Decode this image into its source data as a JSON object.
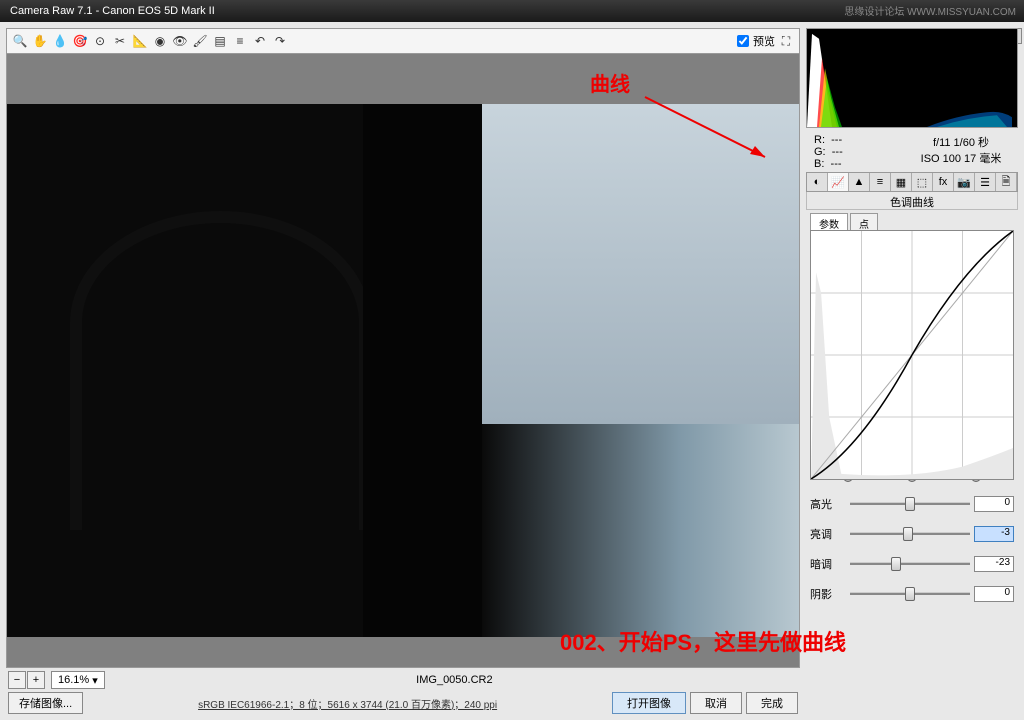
{
  "titlebar": {
    "text": "Camera Raw 7.1  -  Canon EOS 5D Mark II"
  },
  "watermark": "思缘设计论坛  WWW.MISSYUAN.COM",
  "toolbar": {
    "preview_label": "预览"
  },
  "annotations": {
    "curve_label": "曲线",
    "bottom_label": "002、开始PS，这里先做曲线"
  },
  "bottom": {
    "zoom": "16.1%",
    "filename": "IMG_0050.CR2"
  },
  "footer": {
    "save": "存储图像...",
    "meta": "sRGB IEC61966-2.1；8 位；5616 x 3744 (21.0 百万像素)；240 ppi",
    "open": "打开图像",
    "cancel": "取消",
    "done": "完成"
  },
  "info": {
    "r": "R:",
    "g": "G:",
    "b": "B:",
    "dash": "---",
    "exif1": "f/11  1/60 秒",
    "exif2": "ISO 100  17 毫米"
  },
  "panel": {
    "title": "色调曲线",
    "tab_param": "参数",
    "tab_point": "点"
  },
  "sliders": {
    "highlights": {
      "label": "高光",
      "value": "0",
      "pos": 50
    },
    "lights": {
      "label": "亮调",
      "value": "-3",
      "pos": 48,
      "hl": true
    },
    "darks": {
      "label": "暗调",
      "value": "-23",
      "pos": 38
    },
    "shadows": {
      "label": "阴影",
      "value": "0",
      "pos": 50
    }
  },
  "chart_data": {
    "type": "line",
    "title": "色调曲线",
    "xlabel": "",
    "ylabel": "",
    "x": [
      0,
      64,
      128,
      192,
      255
    ],
    "series": [
      {
        "name": "curve",
        "values": [
          0,
          50,
          128,
          200,
          255
        ]
      }
    ],
    "xlim": [
      0,
      255
    ],
    "ylim": [
      0,
      255
    ],
    "region_markers": [
      64,
      128,
      192
    ]
  }
}
